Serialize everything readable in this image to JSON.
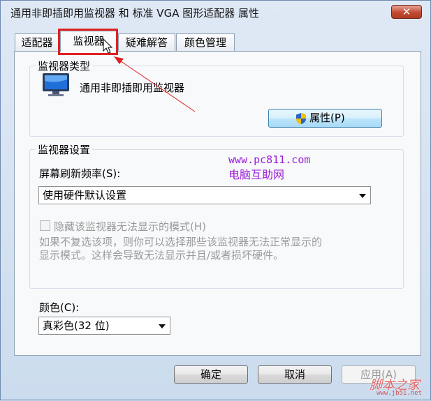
{
  "window": {
    "title": "通用非即插即用监视器 和 标准 VGA 图形适配器 属性",
    "close_glyph": "✕"
  },
  "tabs": [
    {
      "label": "适配器"
    },
    {
      "label": "监视器",
      "active": true
    },
    {
      "label": "疑难解答"
    },
    {
      "label": "颜色管理"
    }
  ],
  "monitor_type": {
    "group_label": "监视器类型",
    "monitor_name": "通用非即插即用监视器",
    "properties_button": "属性(P)"
  },
  "monitor_settings": {
    "group_label": "监视器设置",
    "refresh_label": "屏幕刷新频率(S):",
    "refresh_value": "使用硬件默认设置",
    "hide_modes_label": "隐藏该监视器无法显示的模式(H)",
    "hide_modes_checked": false,
    "description_line1": "如果不复选该项，则你可以选择那些该监视器无法正常显示的",
    "description_line2": "显示模式。这样会导致无法显示并且/或者损坏硬件。"
  },
  "colors": {
    "label": "颜色(C):",
    "value": "真彩色(32 位)"
  },
  "footer": {
    "ok": "确定",
    "cancel": "取消",
    "apply": "应用(A)"
  },
  "watermarks": {
    "site_url": "www.pc811.com",
    "site_name": "电脑互助网",
    "corner_name": "脚本之家",
    "corner_url": "www.jb51.net"
  },
  "colors_palette": {
    "annotation_red": "#e02020",
    "watermark_purple": "#9b1fd8"
  }
}
